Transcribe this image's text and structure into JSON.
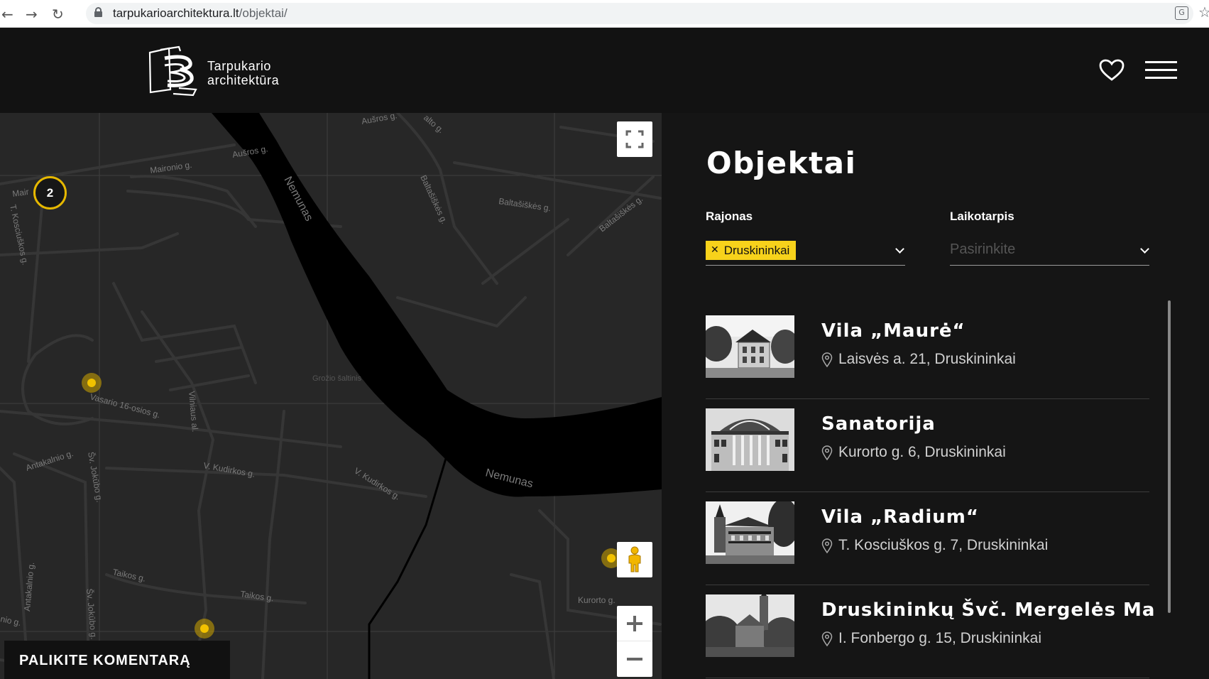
{
  "browser": {
    "url_domain": "tarpukarioarchitektura.lt",
    "url_path": "/objektai/"
  },
  "header": {
    "logo_line1": "Tarpukario",
    "logo_line2": "architektūra"
  },
  "map": {
    "cluster_count": "2",
    "comment_button": "PALIKITE KOMENTARĄ",
    "labels": {
      "ausros_g": "Aušros g.",
      "ausros_g2": "Aušros g.",
      "maironio_g": "Maironio g.",
      "mair": "Mair",
      "kosciuskos_g": "T. Kosciuškos g.",
      "nemunas_1": "Nemunas",
      "nemunas_2": "Nemunas",
      "baltasiskes_1": "Baltašiškės g.",
      "baltasiskes_2": "Baltašiškės g.",
      "baltasiskes_3": "Baltašiškės g.",
      "vasario": "Vasario 16-osios g.",
      "vilniaus": "Vilniaus al.",
      "grozio": "Grožio šaltinis",
      "antakalnio_1": "Antakalnio g.",
      "antakalnio_2": "Antakalnio g.",
      "sv_jokubo_1": "Šv. Jokūbo g.",
      "sv_jokubo_2": "Šv. Jokūbo g.",
      "kudirkos_1": "V. Kudirkos g.",
      "kudirkos_2": "V. Kudirkos g.",
      "taikos_1": "Taikos g.",
      "taikos_2": "Taikos g.",
      "kurorto": "Kurorto g.",
      "alto": "alto g.",
      "nio": "nio g."
    }
  },
  "panel": {
    "title": "Objektai",
    "filter_district_label": "Rajonas",
    "filter_district_value": "Druskininkai",
    "filter_period_label": "Laikotarpis",
    "filter_period_placeholder": "Pasirinkite",
    "items": [
      {
        "title": "Vila „Maurė“",
        "address": "Laisvės a. 21, Druskininkai"
      },
      {
        "title": "Sanatorija",
        "address": "Kurorto g. 6, Druskininkai"
      },
      {
        "title": "Vila „Radium“",
        "address": "T. Kosciuškos g. 7, Druskininkai"
      },
      {
        "title": "Druskininkų Švč. Mergelės Ma",
        "address": "I. Fonbergo g. 15, Druskininkai"
      }
    ]
  },
  "colors": {
    "accent": "#f7d21b",
    "marker": "#f2c200",
    "background": "#121212",
    "map": "#272727",
    "river": "#000000"
  }
}
